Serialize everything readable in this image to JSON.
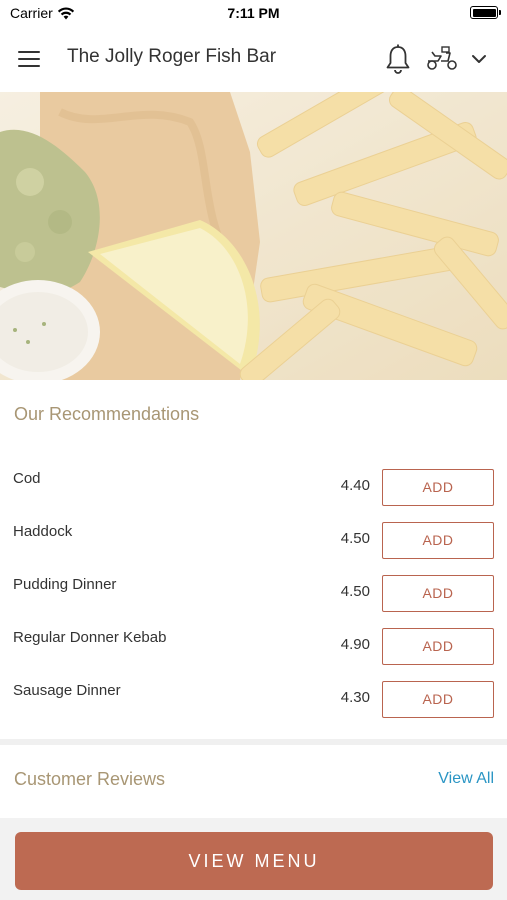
{
  "status_bar": {
    "carrier": "Carrier",
    "time": "7:11 PM",
    "battery_level": 1.0
  },
  "header": {
    "title": "The Jolly Roger Fish Bar",
    "icons": [
      "menu-icon",
      "bell-icon",
      "scooter-icon",
      "chevron-down-icon"
    ]
  },
  "recommendations": {
    "title": "Our Recommendations",
    "items": [
      {
        "name": "Cod",
        "price": "4.40",
        "add_label": "ADD"
      },
      {
        "name": "Haddock",
        "price": "4.50",
        "add_label": "ADD"
      },
      {
        "name": "Pudding Dinner",
        "price": "4.50",
        "add_label": "ADD"
      },
      {
        "name": "Regular Donner Kebab",
        "price": "4.90",
        "add_label": "ADD"
      },
      {
        "name": "Sausage Dinner",
        "price": "4.30",
        "add_label": "ADD"
      }
    ]
  },
  "reviews": {
    "title": "Customer Reviews",
    "view_all_label": "View All"
  },
  "footer": {
    "view_menu_label": "VIEW MENU"
  },
  "colors": {
    "accent": "#bd6a52",
    "section_title": "#a89674",
    "link": "#2a95c4"
  }
}
